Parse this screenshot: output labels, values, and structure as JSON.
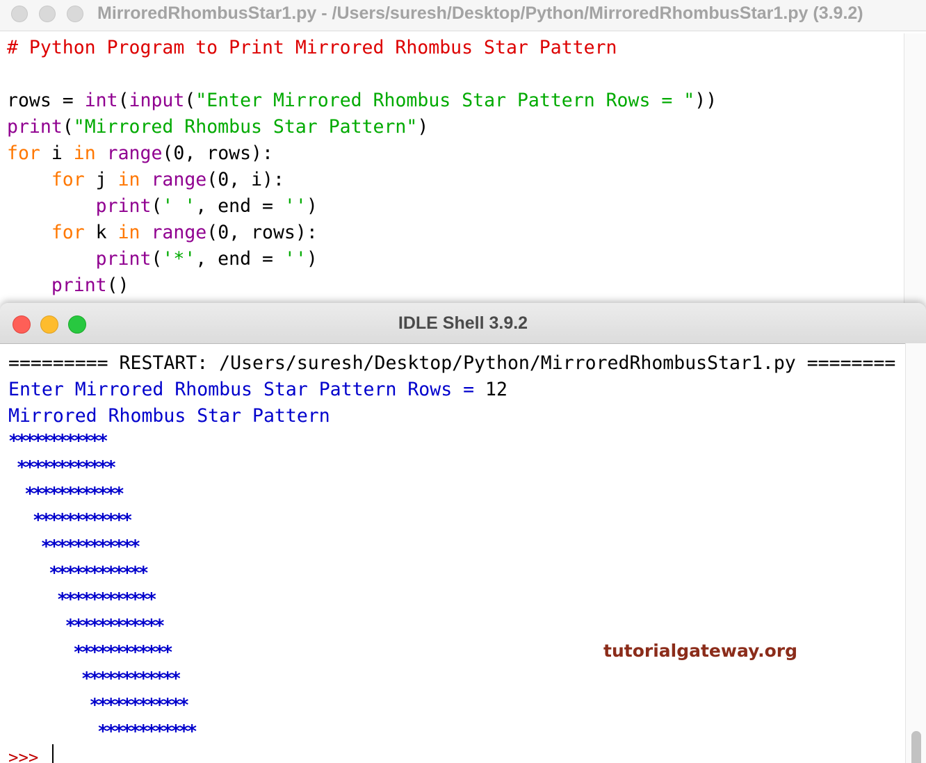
{
  "editor": {
    "title": "MirroredRhombusStar1.py - /Users/suresh/Desktop/Python/MirroredRhombusStar1.py (3.9.2)",
    "code": {
      "comment": "# Python Program to Print Mirrored Rhombus Star Pattern",
      "line2": {
        "v1": "rows",
        "eq": " = ",
        "f1": "int",
        "p1": "(",
        "f2": "input",
        "p2": "(",
        "s": "\"Enter Mirrored Rhombus Star Pattern Rows = \"",
        "p3": "))"
      },
      "line3": {
        "f": "print",
        "p1": "(",
        "s": "\"Mirrored Rhombus Star Pattern\"",
        "p2": ")"
      },
      "line4": {
        "kw1": "for",
        "v": " i ",
        "kw2": "in",
        "sp": " ",
        "f": "range",
        "rest": "(0, rows):"
      },
      "line5": {
        "indent": "    ",
        "kw1": "for",
        "v": " j ",
        "kw2": "in",
        "sp": " ",
        "f": "range",
        "rest": "(0, i):"
      },
      "line6": {
        "indent": "        ",
        "f": "print",
        "p1": "(",
        "s1": "' '",
        "mid": ", end = ",
        "s2": "''",
        "p2": ")"
      },
      "line7": {
        "indent": "    ",
        "kw1": "for",
        "v": " k ",
        "kw2": "in",
        "sp": " ",
        "f": "range",
        "rest": "(0, rows):"
      },
      "line8": {
        "indent": "        ",
        "f": "print",
        "p1": "(",
        "s1": "'*'",
        "mid": ", end = ",
        "s2": "''",
        "p2": ")"
      },
      "line9": {
        "indent": "    ",
        "f": "print",
        "p": "()"
      }
    }
  },
  "shell": {
    "title": "IDLE Shell 3.9.2",
    "restart_line": "========= RESTART: /Users/suresh/Desktop/Python/MirroredRhombusStar1.py ========",
    "input_prompt": "Enter Mirrored Rhombus Star Pattern Rows = ",
    "input_value": "12",
    "output_heading": "Mirrored Rhombus Star Pattern",
    "star_rows": [
      "************",
      " ************",
      "  ************",
      "   ************",
      "    ************",
      "     ************",
      "      ************",
      "       ************",
      "        ************",
      "         ************",
      "          ************",
      "           ************"
    ],
    "prompt": ">>>",
    "watermark": "tutorialgateway.org"
  }
}
